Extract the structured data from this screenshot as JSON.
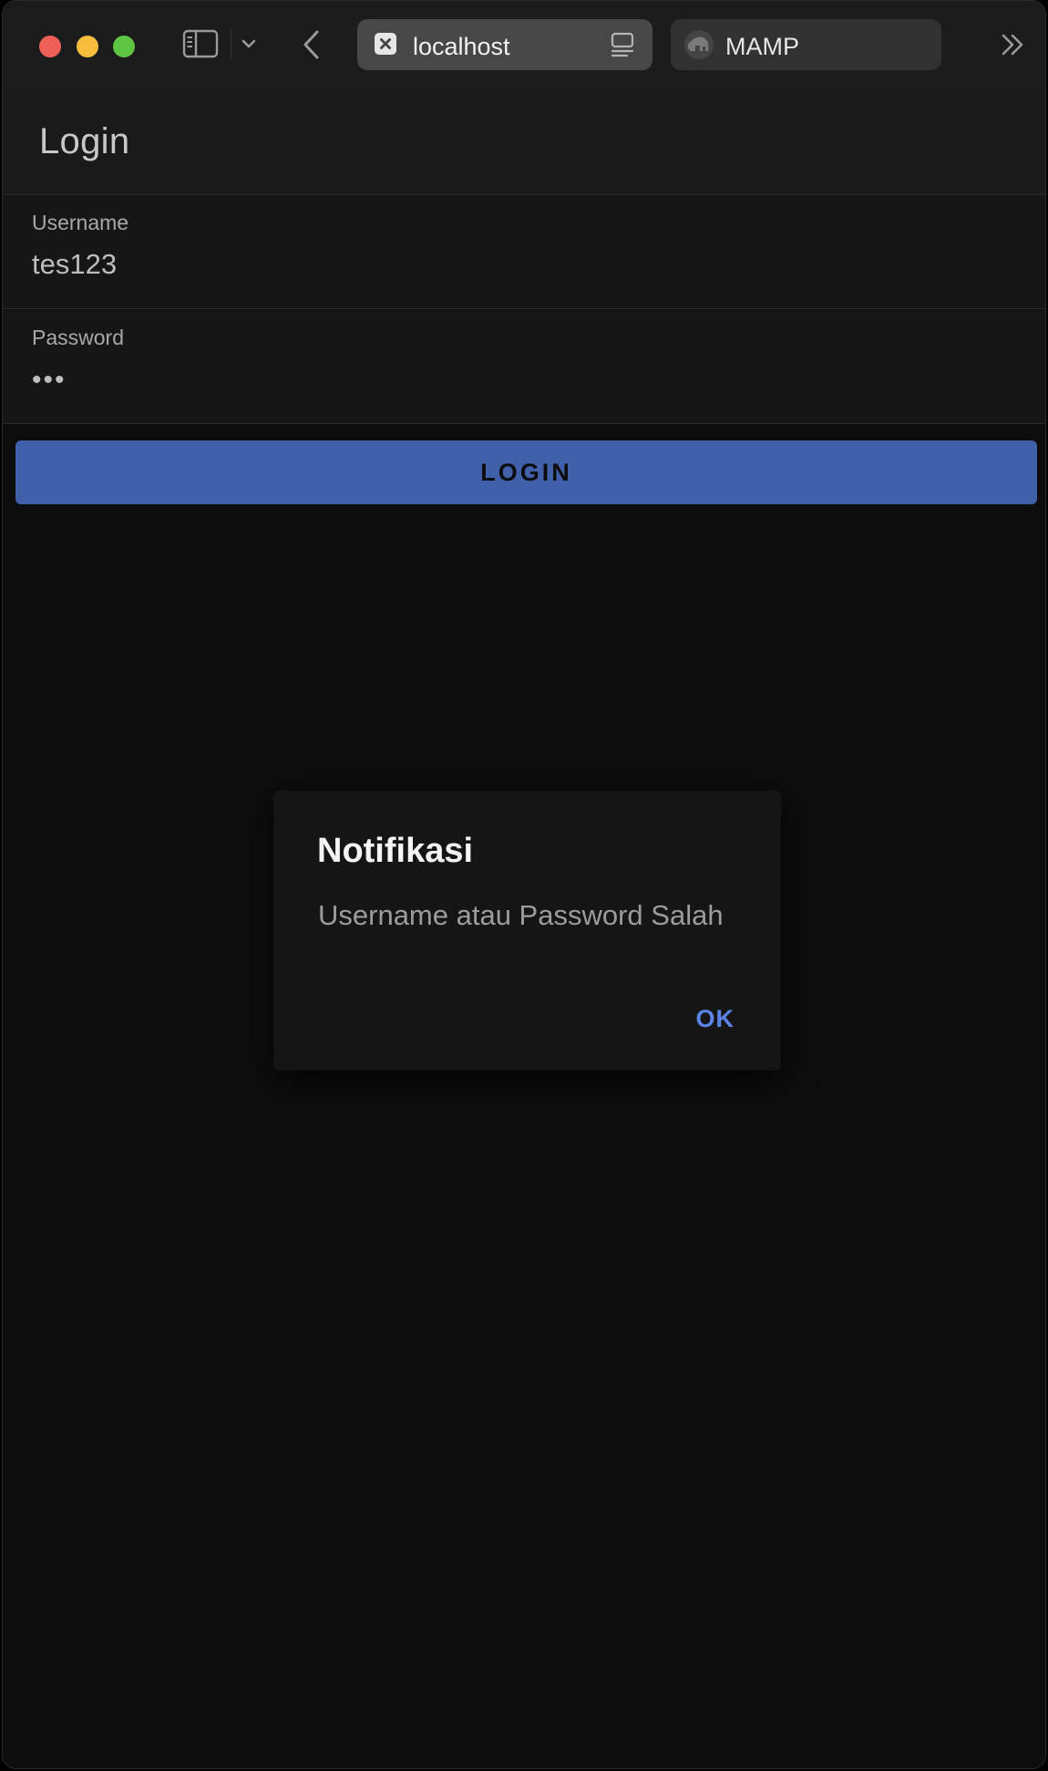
{
  "browser": {
    "tabs": [
      {
        "title": "localhost",
        "active": true,
        "favicon": "close-box-icon"
      },
      {
        "title": "MAMP",
        "active": false,
        "favicon": "elephant-icon"
      }
    ]
  },
  "app": {
    "header_title": "Login",
    "username": {
      "label": "Username",
      "value": "tes123"
    },
    "password": {
      "label": "Password",
      "value": "•••"
    },
    "login_button": "LOGIN"
  },
  "dialog": {
    "title": "Notifikasi",
    "message": "Username atau Password Salah",
    "ok_label": "OK"
  },
  "colors": {
    "primary_button": "#4060aa",
    "dialog_action": "#5b84e6",
    "traffic_red": "#ee5f58",
    "traffic_yellow": "#f6bd3e",
    "traffic_green": "#5dc542"
  }
}
